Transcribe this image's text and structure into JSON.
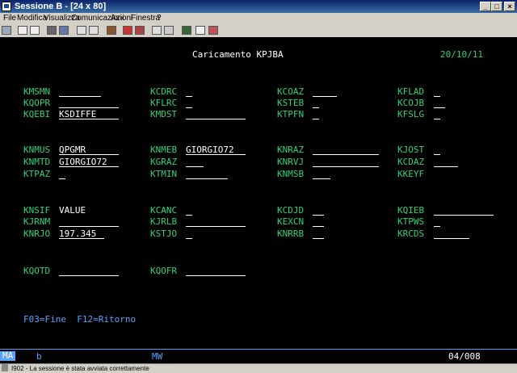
{
  "window": {
    "title": "Sessione B - [24 x 80]"
  },
  "menu": [
    "File",
    "Modifica",
    "Visualizza",
    "Comunicazioni",
    "Azioni",
    "Finestra",
    "?"
  ],
  "screen": {
    "title": "Caricamento KPJBA",
    "date": "20/10/11",
    "fkeys": "F03=Fine  F12=Ritorno",
    "fields": [
      {
        "label": "KMSMN",
        "value": ""
      },
      {
        "label": "KCDRC",
        "value": ""
      },
      {
        "label": "KCOAZ",
        "value": ""
      },
      {
        "label": "KFLAD",
        "value": ""
      },
      {
        "label": "KQOPR",
        "value": ""
      },
      {
        "label": "KFLRC",
        "value": ""
      },
      {
        "label": "KSTEB",
        "value": ""
      },
      {
        "label": "KCOJB",
        "value": ""
      },
      {
        "label": "KQEBI",
        "value": "KSDIFFE"
      },
      {
        "label": "KMDST",
        "value": ""
      },
      {
        "label": "KTPFN",
        "value": ""
      },
      {
        "label": "KFSLG",
        "value": ""
      },
      {
        "label": "KNMUS",
        "value": "QPGMR"
      },
      {
        "label": "KNMEB",
        "value": "GIORGIO72"
      },
      {
        "label": "KNRAZ",
        "value": ""
      },
      {
        "label": "KJOST",
        "value": ""
      },
      {
        "label": "KNMTD",
        "value": "GIORGIO72"
      },
      {
        "label": "KGRAZ",
        "value": ""
      },
      {
        "label": "KNRVJ",
        "value": ""
      },
      {
        "label": "KCDAZ",
        "value": ""
      },
      {
        "label": "KTPAZ",
        "value": ""
      },
      {
        "label": "KTMIN",
        "value": ""
      },
      {
        "label": "KNMSB",
        "value": ""
      },
      {
        "label": "KKEYF",
        "value": ""
      },
      {
        "label": "KNSIF",
        "value": "VALUE"
      },
      {
        "label": "KCANC",
        "value": ""
      },
      {
        "label": "KCDJD",
        "value": ""
      },
      {
        "label": "KQIEB",
        "value": ""
      },
      {
        "label": "KJRNM",
        "value": ""
      },
      {
        "label": "KJRLB",
        "value": ""
      },
      {
        "label": "KEXCN",
        "value": ""
      },
      {
        "label": "KTPWS",
        "value": ""
      },
      {
        "label": "KNRJO",
        "value": "197.345"
      },
      {
        "label": "KSTJO",
        "value": ""
      },
      {
        "label": "KNRRB",
        "value": ""
      },
      {
        "label": "KRCDS",
        "value": ""
      },
      {
        "label": "KQOTD",
        "value": ""
      },
      {
        "label": "KQOFR",
        "value": ""
      }
    ]
  },
  "oia": {
    "mode": "MA",
    "indicator": "b",
    "mw": "MW",
    "position": "04/008"
  },
  "status": {
    "text": "I902 - La sessione è stata avviata correttamente"
  }
}
